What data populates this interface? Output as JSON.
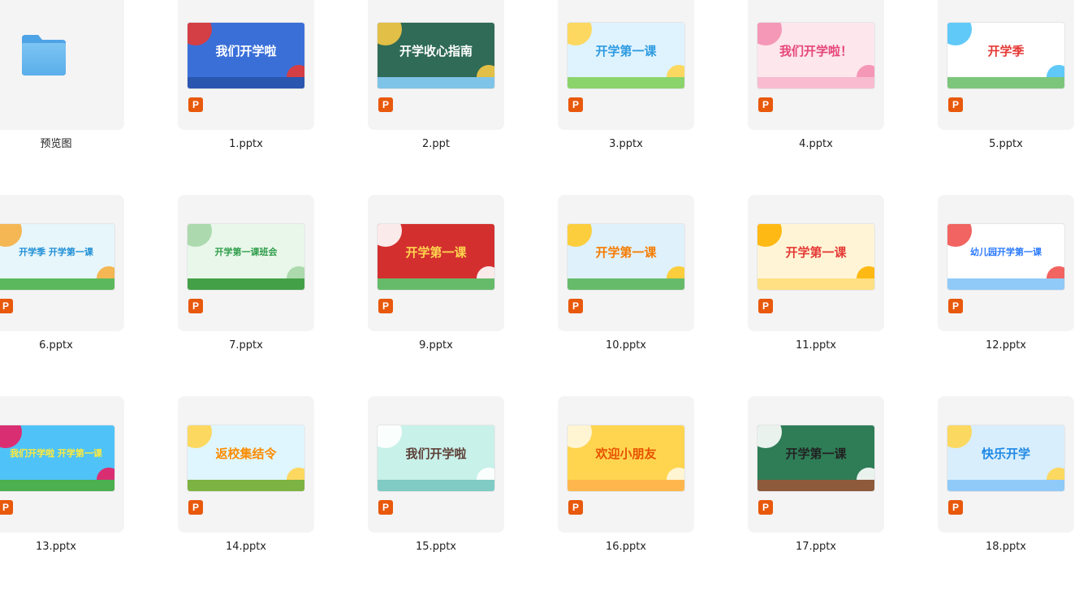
{
  "files": [
    {
      "name": "预览图",
      "kind": "folder"
    },
    {
      "name": "1.pptx",
      "kind": "pptx",
      "thumb_title": "我们开学啦",
      "bg": "#3a6fd8",
      "fg": "#ffffff",
      "accent": "#e53935",
      "ground": "#2a56b0"
    },
    {
      "name": "2.ppt",
      "kind": "pptx",
      "thumb_title": "开学收心指南",
      "bg": "#2f6b56",
      "fg": "#ffffff",
      "accent": "#f6c945",
      "ground": "#7ec4e8"
    },
    {
      "name": "3.pptx",
      "kind": "pptx",
      "thumb_title": "开学第一课",
      "bg": "#dff3ff",
      "fg": "#2e9be0",
      "accent": "#ffd54f",
      "ground": "#8bd36b"
    },
    {
      "name": "4.pptx",
      "kind": "pptx",
      "thumb_title": "我们开学啦！",
      "bg": "#fde6ec",
      "fg": "#e6457a",
      "accent": "#f48fb1",
      "ground": "#f8bbd0"
    },
    {
      "name": "5.pptx",
      "kind": "pptx",
      "thumb_title": "开学季",
      "bg": "#ffffff",
      "fg": "#e53935",
      "accent": "#4fc3f7",
      "ground": "#7bc67b"
    },
    {
      "name": "6.pptx",
      "kind": "pptx",
      "thumb_title": "开学季 开学第一课",
      "bg": "#e7f6fb",
      "fg": "#1f8fd6",
      "accent": "#f5b041",
      "ground": "#5cb85c"
    },
    {
      "name": "7.pptx",
      "kind": "pptx",
      "thumb_title": "开学第一课班会",
      "bg": "#e9f7ea",
      "fg": "#2e9d4a",
      "accent": "#a5d6a7",
      "ground": "#43a047"
    },
    {
      "name": "9.pptx",
      "kind": "pptx",
      "thumb_title": "开学第一课",
      "bg": "#d32f2f",
      "fg": "#ffd54f",
      "accent": "#ffffff",
      "ground": "#66bb6a"
    },
    {
      "name": "10.pptx",
      "kind": "pptx",
      "thumb_title": "开学第一课",
      "bg": "#dff1fb",
      "fg": "#f57c00",
      "accent": "#ffca28",
      "ground": "#66bb6a"
    },
    {
      "name": "11.pptx",
      "kind": "pptx",
      "thumb_title": "开学第一课",
      "bg": "#fff5d6",
      "fg": "#e53935",
      "accent": "#ffb300",
      "ground": "#ffe082"
    },
    {
      "name": "12.pptx",
      "kind": "pptx",
      "thumb_title": "幼儿园开学第一课",
      "bg": "#ffffff",
      "fg": "#2979ff",
      "accent": "#ef5350",
      "ground": "#90caf9"
    },
    {
      "name": "13.pptx",
      "kind": "pptx",
      "thumb_title": "我们开学啦 开学第一课",
      "bg": "#4fc3f7",
      "fg": "#ffeb3b",
      "accent": "#e91e63",
      "ground": "#4caf50"
    },
    {
      "name": "14.pptx",
      "kind": "pptx",
      "thumb_title": "返校集结令",
      "bg": "#dff6ff",
      "fg": "#fb8c00",
      "accent": "#ffd54f",
      "ground": "#7cb342"
    },
    {
      "name": "15.pptx",
      "kind": "pptx",
      "thumb_title": "我们开学啦",
      "bg": "#c8f1ea",
      "fg": "#5d4037",
      "accent": "#ffffff",
      "ground": "#80cbc4"
    },
    {
      "name": "16.pptx",
      "kind": "pptx",
      "thumb_title": "欢迎小朋友",
      "bg": "#ffd54f",
      "fg": "#e65100",
      "accent": "#fff8e1",
      "ground": "#ffb74d"
    },
    {
      "name": "17.pptx",
      "kind": "pptx",
      "thumb_title": "开学第一课",
      "bg": "#2e7d57",
      "fg": "#222222",
      "accent": "#ffffff",
      "ground": "#8d5a3b"
    },
    {
      "name": "18.pptx",
      "kind": "pptx",
      "thumb_title": "快乐开学",
      "bg": "#d8eefc",
      "fg": "#1e88e5",
      "accent": "#ffd54f",
      "ground": "#90caf9"
    }
  ],
  "badge_letter": "P"
}
